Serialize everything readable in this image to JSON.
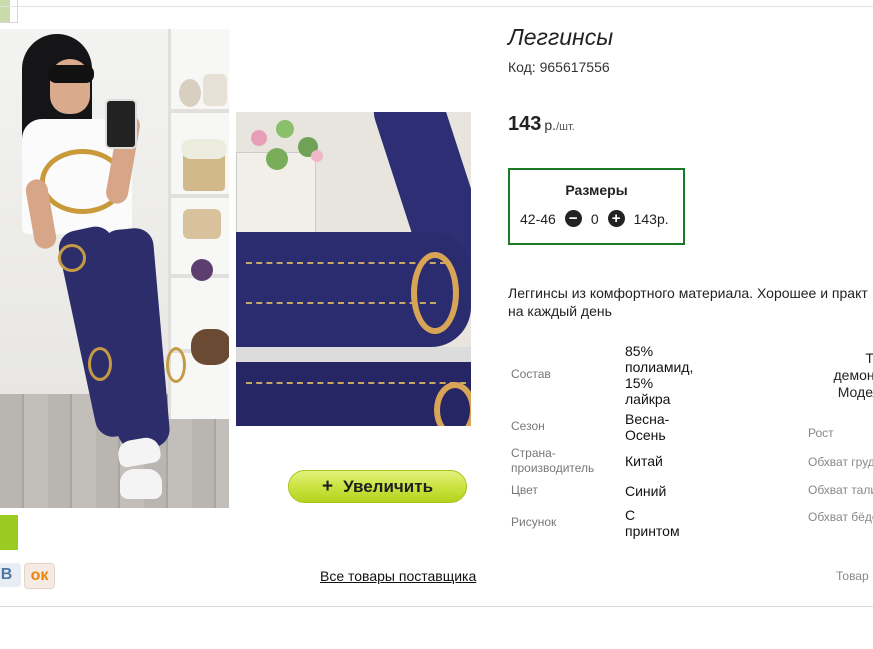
{
  "product": {
    "title": "Леггинсы",
    "code": "Код: 965617556",
    "price": "143",
    "price_unit": "р.",
    "price_per": "/шт.",
    "description": [
      "Леггинсы из комфортного материала. Хорошее и практ",
      "на каждый день"
    ],
    "zoom_button": "Увеличить",
    "zoom_plus": "+",
    "supplier_link": "Все товары поставщика"
  },
  "sizes": {
    "header": "Размеры",
    "size": "42-46",
    "quantity": "0",
    "row_price": "143р."
  },
  "specs": [
    {
      "label": "Состав",
      "value": [
        "85%",
        "полиамид,",
        "15%",
        "лайкра"
      ]
    },
    {
      "label": "Сезон",
      "value": [
        "Весна-",
        "Осень"
      ]
    },
    {
      "label": "Страна-производитель",
      "label_lines": [
        "Страна-",
        "производитель"
      ],
      "value": [
        "Китай"
      ]
    },
    {
      "label": "Цвет",
      "value": [
        "Синий"
      ]
    },
    {
      "label": "Рисунок",
      "value": [
        "С",
        "принтом"
      ]
    }
  ],
  "right_panel": {
    "head": [
      "Тов",
      "демонст",
      "Модель"
    ],
    "rows": [
      "Рост",
      "Обхват груди",
      "Обхват талии",
      "Обхват бёдер"
    ],
    "bottom": "Товар"
  },
  "social": {
    "vk": "В",
    "ok": "ок"
  },
  "colors": {
    "accent_border": "#1d7a24",
    "button_green": "#c8e23c",
    "swatch": "#9bcb23"
  }
}
